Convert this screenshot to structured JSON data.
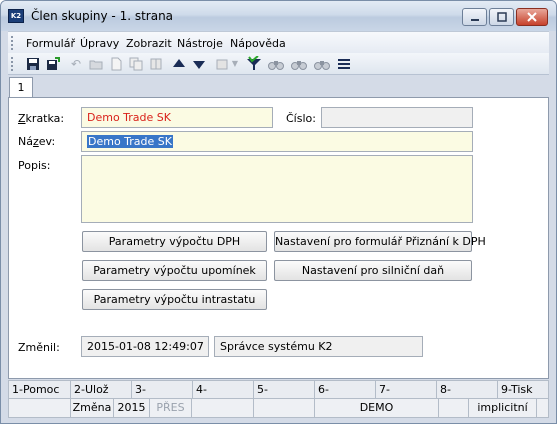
{
  "window": {
    "title": "Člen skupiny - 1. strana",
    "app_icon_text": "K2"
  },
  "menu": {
    "items": [
      "Formulář",
      "Úpravy",
      "Zobrazit",
      "Nástroje",
      "Nápověda"
    ]
  },
  "toolbar": {
    "icons": [
      "save-icon",
      "save-as-icon",
      "undo-icon",
      "open-folder-icon",
      "new-document-icon",
      "copy-document-icon",
      "book-icon",
      "arrow-up-icon",
      "arrow-down-icon",
      "options-icon",
      "filter-check-icon",
      "binoculars-icon",
      "binoculars-next-icon",
      "binoculars-prev-icon",
      "menu-lines-icon"
    ]
  },
  "tabs": [
    {
      "label": "1"
    }
  ],
  "form": {
    "zkratka": {
      "label_u": "Z",
      "label_rest": "kratka:",
      "value": "Demo Trade SK"
    },
    "cislo": {
      "label": "Číslo:",
      "value": ""
    },
    "nazev": {
      "label_a": "Ná",
      "label_u": "z",
      "label_b": "ev:",
      "value": "Demo Trade SK"
    },
    "popis": {
      "label": "Popis:",
      "value": ""
    },
    "buttons": {
      "dph": "Parametry výpočtu DPH",
      "priznani": "Nastavení pro formulář Přiznání k DPH",
      "upominek": "Parametry výpočtu upomínek",
      "silnicni": "Nastavení pro silniční daň",
      "intrastat": "Parametry výpočtu intrastatu"
    },
    "zmenil": {
      "label": "Změnil:",
      "timestamp": "2015-01-08 12:49:07",
      "user": "Správce systému K2"
    }
  },
  "fkeys": [
    "1-Pomoc",
    "2-Ulož",
    "3-",
    "4-",
    "5-",
    "6-",
    "7-",
    "8-",
    "9-Tisk"
  ],
  "status": {
    "mode": "Změna",
    "year": "2015",
    "insert_mode": "PŘES",
    "company": "DEMO",
    "default": "implicitní"
  },
  "colors": {
    "field_bg": "#fbfbe3",
    "red_text": "#d9221b",
    "selection": "#3876c8"
  }
}
